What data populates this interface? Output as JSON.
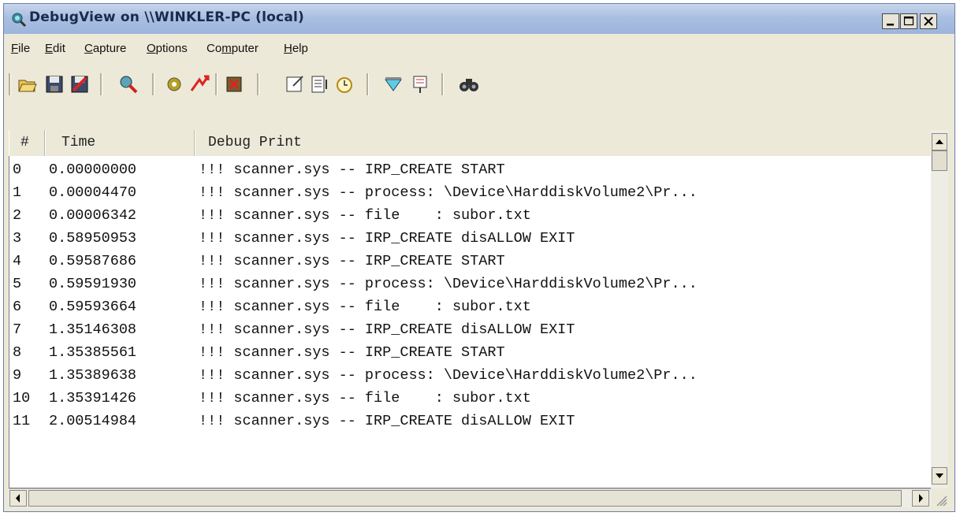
{
  "window": {
    "title": "DebugView on \\\\WINKLER-PC (local)",
    "minimize_label": "_",
    "maximize_label": "□",
    "close_label": "×"
  },
  "menu": [
    {
      "first": "F",
      "rest": "ile"
    },
    {
      "first": "E",
      "rest": "dit"
    },
    {
      "first": "C",
      "rest": "apture"
    },
    {
      "first": "O",
      "rest": "ptions"
    },
    {
      "first": "Co",
      "rest": "mputer",
      "underline_index": 2
    },
    {
      "first": "H",
      "rest": "elp"
    }
  ],
  "toolbar": {
    "buttons": [
      "open-icon",
      "save-icon",
      "clear-icon",
      "capture-kernel-icon",
      "capture-win32-icon",
      "capture-events-icon",
      "autoscroll-icon",
      "clear-display-icon",
      "time-icon",
      "clock-icon",
      "filter-icon",
      "highlight-icon",
      "find-icon"
    ]
  },
  "table": {
    "columns": [
      "#",
      "Time",
      "Debug Print"
    ],
    "rows": [
      {
        "num": "0",
        "time": "0.00000000",
        "text": "!!! scanner.sys -- IRP_CREATE START"
      },
      {
        "num": "1",
        "time": "0.00004470",
        "text": "!!! scanner.sys -- process: \\Device\\HarddiskVolume2\\Pr..."
      },
      {
        "num": "2",
        "time": "0.00006342",
        "text": "!!! scanner.sys -- file    : subor.txt"
      },
      {
        "num": "3",
        "time": "0.58950953",
        "text": "!!! scanner.sys -- IRP_CREATE disALLOW EXIT"
      },
      {
        "num": "4",
        "time": "0.59587686",
        "text": "!!! scanner.sys -- IRP_CREATE START"
      },
      {
        "num": "5",
        "time": "0.59591930",
        "text": "!!! scanner.sys -- process: \\Device\\HarddiskVolume2\\Pr..."
      },
      {
        "num": "6",
        "time": "0.59593664",
        "text": "!!! scanner.sys -- file    : subor.txt"
      },
      {
        "num": "7",
        "time": "1.35146308",
        "text": "!!! scanner.sys -- IRP_CREATE disALLOW EXIT"
      },
      {
        "num": "8",
        "time": "1.35385561",
        "text": "!!! scanner.sys -- IRP_CREATE START"
      },
      {
        "num": "9",
        "time": "1.35389638",
        "text": "!!! scanner.sys -- process: \\Device\\HarddiskVolume2\\Pr..."
      },
      {
        "num": "10",
        "time": "1.35391426",
        "text": "!!! scanner.sys -- file    : subor.txt"
      },
      {
        "num": "11",
        "time": "2.00514984",
        "text": "!!! scanner.sys -- IRP_CREATE disALLOW EXIT"
      }
    ]
  },
  "scroll": {
    "up_arrow": "▲",
    "down_arrow": "▼",
    "left_arrow": "◀",
    "right_arrow": "▶"
  },
  "colors": {
    "title_text": "#1a2a4a",
    "frame": "#ece9d8"
  }
}
